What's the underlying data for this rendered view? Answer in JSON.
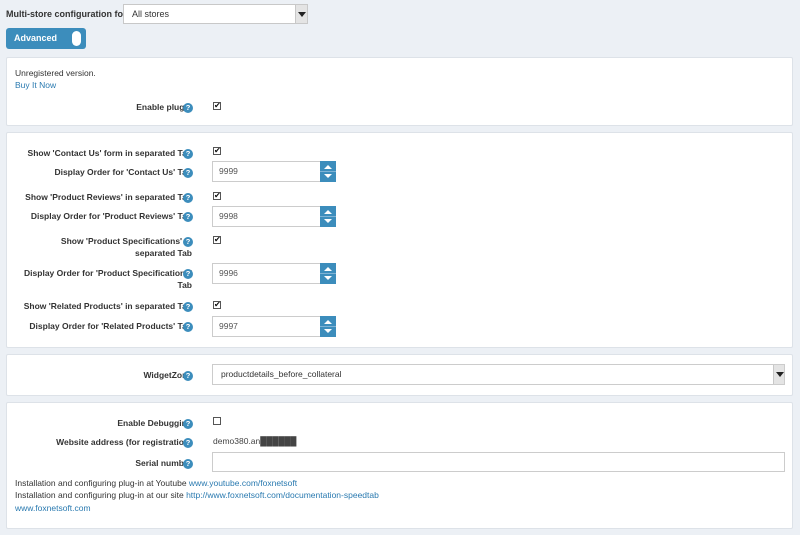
{
  "header": {
    "multistore_label": "Multi-store configuration for",
    "store_value": "All stores",
    "advanced_label": "Advanced"
  },
  "license": {
    "unregistered_text": "Unregistered version.",
    "buy_link": "Buy It Now",
    "enable_plugin_label": "Enable plugin",
    "enable_plugin_checked": true
  },
  "tabs": {
    "contact_show_label": "Show 'Contact Us' form in separated Tab",
    "contact_order_label": "Display Order for 'Contact Us' Tab",
    "contact_order_value": "9999",
    "reviews_show_label": "Show 'Product Reviews' in separated Tab",
    "reviews_order_label": "Display Order for 'Product Reviews' Tab",
    "reviews_order_value": "9998",
    "specs_show_label_line1": "Show 'Product Specifications' in",
    "specs_show_label_line2": "separated Tab",
    "specs_order_label_line1": "Display Order for 'Product Specifications'",
    "specs_order_label_line2": "Tab",
    "specs_order_value": "9996",
    "related_show_label": "Show 'Related Products' in separated Tab",
    "related_order_label": "Display Order for 'Related Products' Tab",
    "related_order_value": "9997"
  },
  "widget": {
    "label": "WidgetZone",
    "value": "productdetails_before_collateral"
  },
  "debug": {
    "enable_debugging_label": "Enable Debugging",
    "website_label": "Website address (for registration)",
    "website_value": "demo380.an██████",
    "serial_label": "Serial number",
    "serial_value": "",
    "youtube_text": "Installation and configuring plug-in at Youtube ",
    "youtube_link": "www.youtube.com/foxnetsoft",
    "site_text": "Installation and configuring plug-in at our site ",
    "site_link": "http://www.foxnetsoft.com/documentation-speedtab",
    "home_link": "www.foxnetsoft.com"
  },
  "icons": {
    "help": "?",
    "check": "✔"
  }
}
